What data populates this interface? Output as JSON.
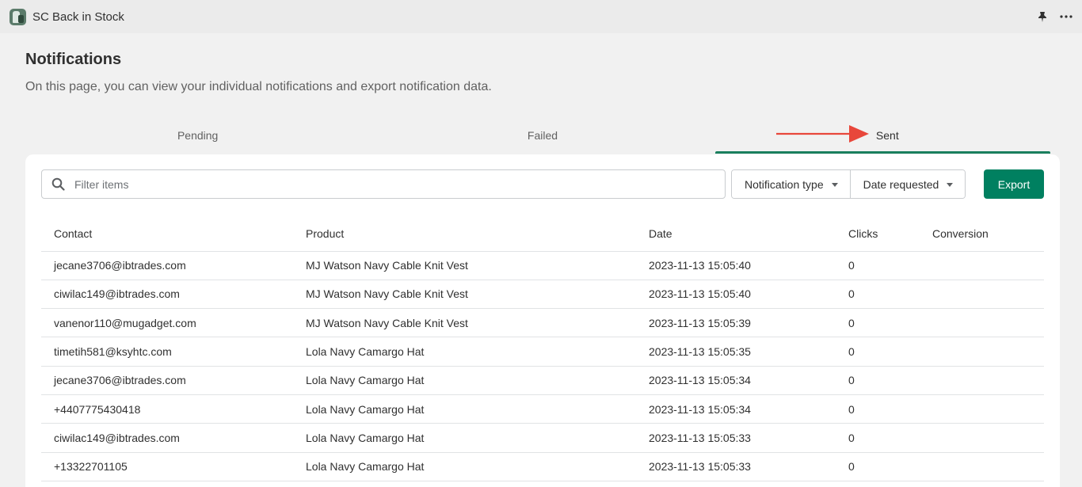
{
  "app": {
    "title": "SC Back in Stock",
    "logo_icon": "app-logo-icon",
    "pin_icon": "pin-icon",
    "more_icon": "more-horizontal-icon"
  },
  "page": {
    "title": "Notifications",
    "description": "On this page, you can view your individual notifications and export notification data."
  },
  "tabs": [
    {
      "label": "Pending",
      "active": false
    },
    {
      "label": "Failed",
      "active": false
    },
    {
      "label": "Sent",
      "active": true
    }
  ],
  "filters": {
    "search_placeholder": "Filter items",
    "notification_type_label": "Notification type",
    "date_requested_label": "Date requested",
    "export_label": "Export"
  },
  "table": {
    "headers": [
      "Contact",
      "Product",
      "Date",
      "Clicks",
      "Conversion"
    ],
    "rows": [
      [
        "jecane3706@ibtrades.com",
        "MJ Watson Navy Cable Knit Vest",
        "2023-11-13 15:05:40",
        "0",
        ""
      ],
      [
        "ciwilac149@ibtrades.com",
        "MJ Watson Navy Cable Knit Vest",
        "2023-11-13 15:05:40",
        "0",
        ""
      ],
      [
        "vanenor110@mugadget.com",
        "MJ Watson Navy Cable Knit Vest",
        "2023-11-13 15:05:39",
        "0",
        ""
      ],
      [
        "timetih581@ksyhtc.com",
        "Lola Navy Camargo Hat",
        "2023-11-13 15:05:35",
        "0",
        ""
      ],
      [
        "jecane3706@ibtrades.com",
        "Lola Navy Camargo Hat",
        "2023-11-13 15:05:34",
        "0",
        ""
      ],
      [
        "+4407775430418",
        "Lola Navy Camargo Hat",
        "2023-11-13 15:05:34",
        "0",
        ""
      ],
      [
        "ciwilac149@ibtrades.com",
        "Lola Navy Camargo Hat",
        "2023-11-13 15:05:33",
        "0",
        ""
      ],
      [
        "+13322701105",
        "Lola Navy Camargo Hat",
        "2023-11-13 15:05:33",
        "0",
        ""
      ]
    ]
  },
  "colors": {
    "accent": "#008060",
    "tab_indicator": "#1a7f5e",
    "annotation_arrow": "#e8473b"
  }
}
